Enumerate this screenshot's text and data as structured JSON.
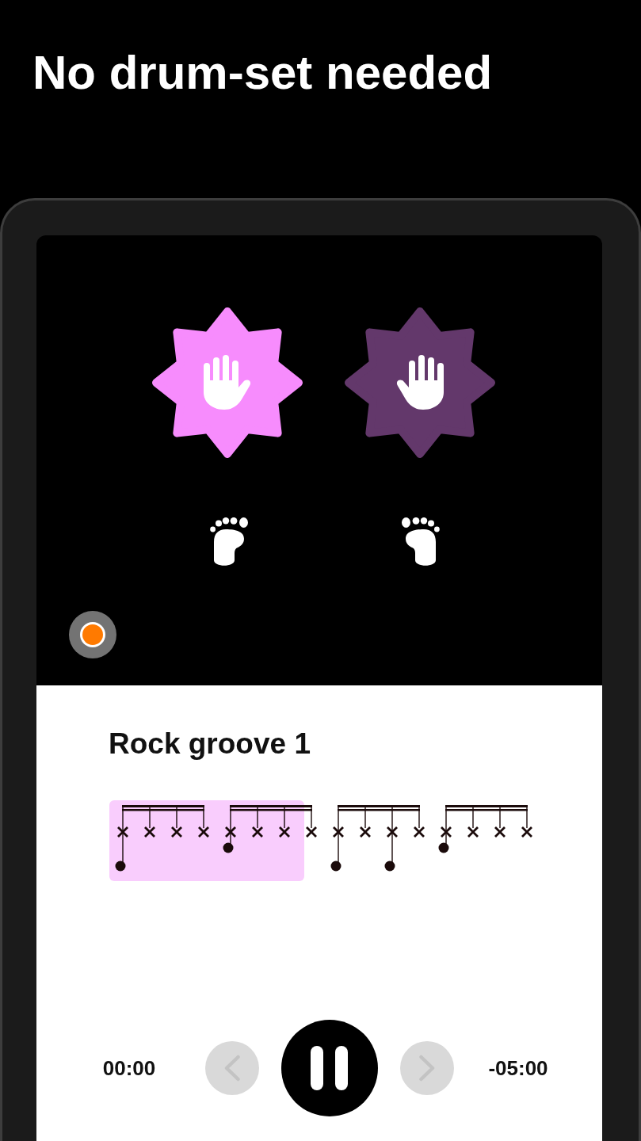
{
  "headline": "No drum-set needed",
  "hand_pads": [
    {
      "mirrored": false,
      "lit": true
    },
    {
      "mirrored": true,
      "lit": false
    }
  ],
  "foot_pads": [
    {
      "mirrored": false
    },
    {
      "mirrored": true
    }
  ],
  "groove": {
    "title": "Rock groove 1",
    "groups": [
      {
        "highlighted": true,
        "steps": [
          {
            "kind": "cross_low_dot"
          },
          {
            "kind": "cross"
          },
          {
            "kind": "cross"
          },
          {
            "kind": "cross"
          }
        ]
      },
      {
        "highlighted": true,
        "steps": [
          {
            "kind": "cross_high_dot"
          },
          {
            "kind": "cross"
          },
          {
            "kind": "cross"
          },
          {
            "kind": "cross"
          }
        ]
      },
      {
        "highlighted": false,
        "steps": [
          {
            "kind": "cross_low_dot"
          },
          {
            "kind": "cross"
          },
          {
            "kind": "cross_low_dot"
          },
          {
            "kind": "cross"
          }
        ]
      },
      {
        "highlighted": false,
        "steps": [
          {
            "kind": "cross_high_dot"
          },
          {
            "kind": "cross"
          },
          {
            "kind": "cross"
          },
          {
            "kind": "cross"
          }
        ]
      }
    ]
  },
  "playback": {
    "elapsed": "00:00",
    "remaining": "-05:00",
    "playing": true,
    "previous": {
      "disabled": true
    },
    "next": {
      "disabled": true
    }
  }
}
